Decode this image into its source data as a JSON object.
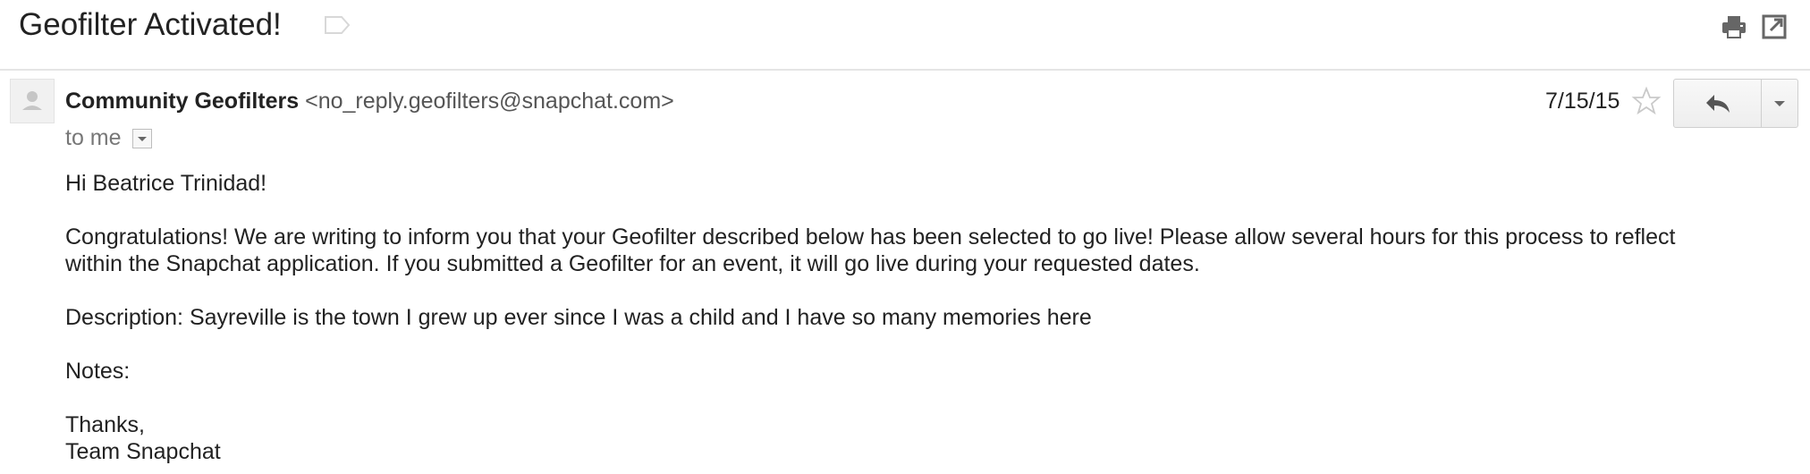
{
  "email": {
    "subject": "Geofilter Activated!",
    "sender": {
      "name": "Community Geofilters",
      "email": "<no_reply.geofilters@snapchat.com>"
    },
    "recipient_text": "to me",
    "date": "7/15/15",
    "body": {
      "greeting": "Hi Beatrice Trinidad!",
      "paragraph_line1": "Congratulations! We are writing to inform you that your Geofilter described below has been selected to go live! Please allow several hours for this process to reflect",
      "paragraph_line2": "within the Snapchat application. If you submitted a Geofilter for an event, it will go live during your requested dates.",
      "description": "Description: Sayreville is the town I grew up ever since I was a child and I have so many memories here",
      "notes": "Notes:",
      "signoff_line1": "Thanks,",
      "signoff_line2": "Team Snapchat"
    }
  },
  "icons": {
    "label": "label-icon",
    "print": "print-icon",
    "popout": "popout-icon",
    "avatar": "person-avatar-icon",
    "star": "star-icon",
    "reply": "reply-arrow-icon",
    "more": "chevron-down-icon",
    "details": "dropdown-arrow-icon"
  },
  "colors": {
    "text": "#222222",
    "muted": "#777777",
    "icon": "#666666",
    "divider": "#e5e5e5"
  }
}
